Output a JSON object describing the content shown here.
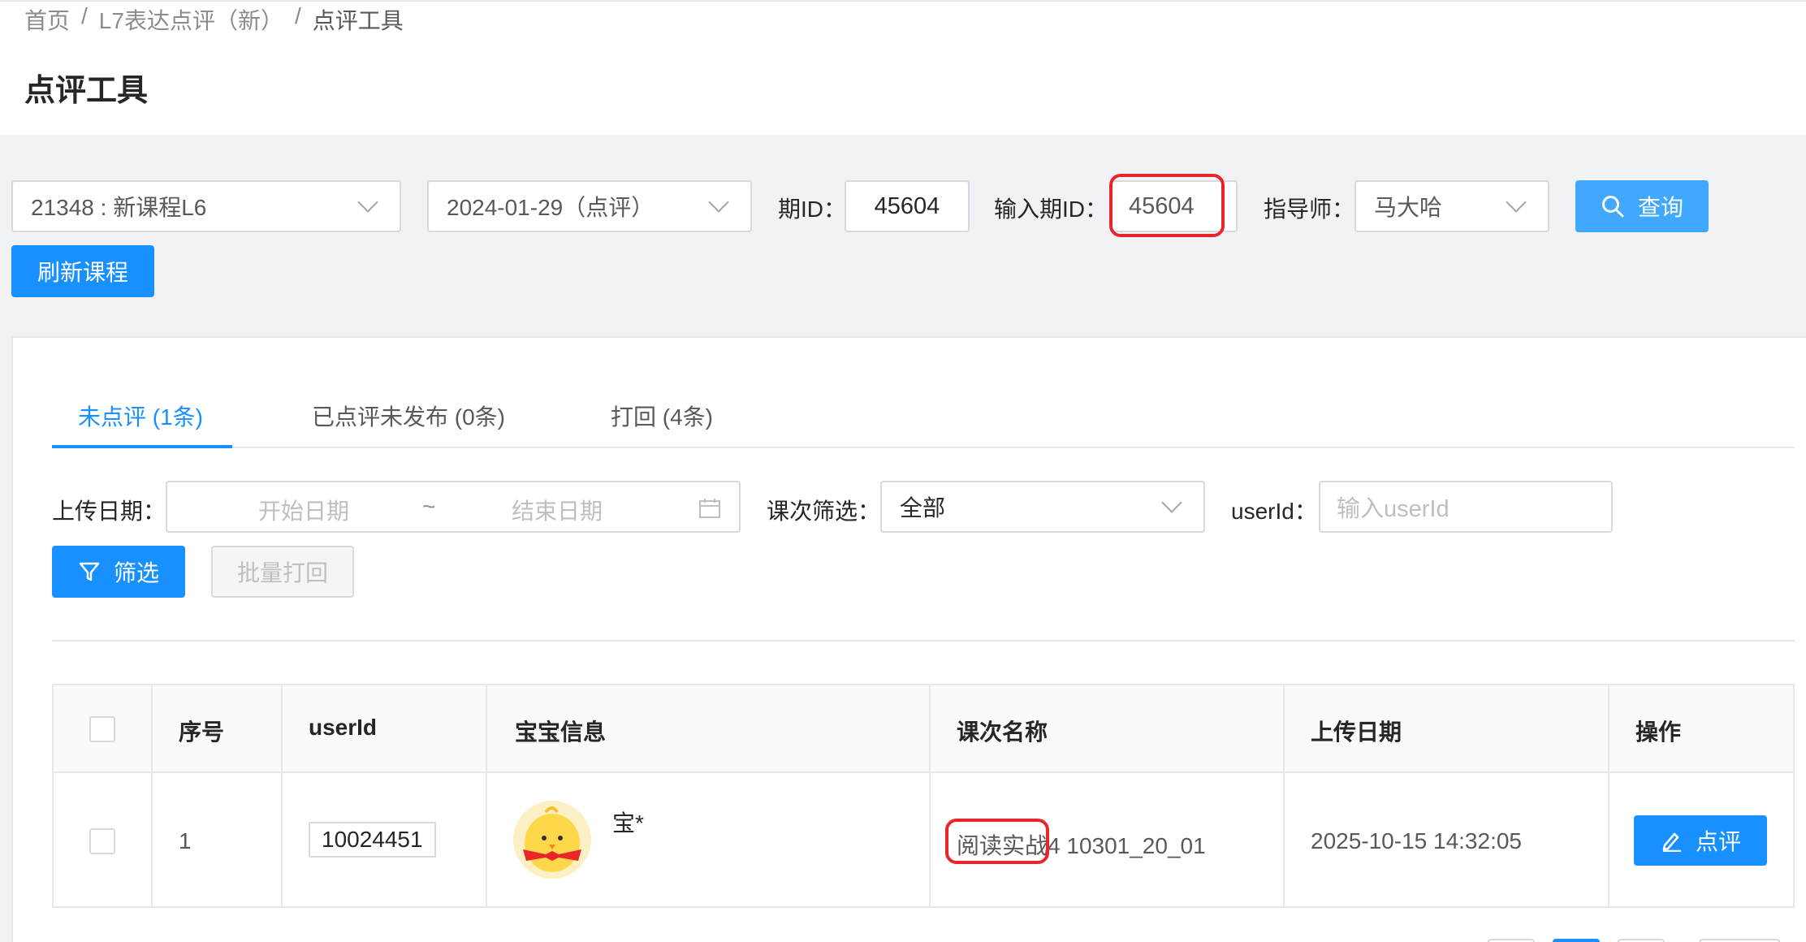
{
  "breadcrumb": {
    "home": "首页",
    "middle": "L7表达点评（新）",
    "current": "点评工具",
    "separator": "/"
  },
  "page_title": "点评工具",
  "toolbar": {
    "course_select": "21348 : 新课程L6",
    "date_select": "2024-01-29（点评）",
    "period_id_label": "期ID：",
    "period_id_value": "45604",
    "input_period_id_label": "输入期ID：",
    "input_period_id_value": "45604",
    "tutor_label": "指导师：",
    "tutor_value": "马大哈",
    "query_button": "查询",
    "refresh_button": "刷新课程"
  },
  "tabs": [
    {
      "label": "未点评 (1条)",
      "active": true
    },
    {
      "label": "已点评未发布 (0条)",
      "active": false
    },
    {
      "label": "打回 (4条)",
      "active": false
    }
  ],
  "filters": {
    "upload_date_label": "上传日期：",
    "start_placeholder": "开始日期",
    "range_sep": "~",
    "end_placeholder": "结束日期",
    "lesson_filter_label": "课次筛选：",
    "lesson_filter_value": "全部",
    "userid_label": "userId：",
    "userid_placeholder": "输入userId",
    "filter_button": "筛选",
    "batch_reject_button": "批量打回"
  },
  "table": {
    "columns": [
      "序号",
      "userId",
      "宝宝信息",
      "课次名称",
      "上传日期",
      "操作"
    ],
    "rows": [
      {
        "index": "1",
        "userId": "10024451",
        "baby_name": "宝*",
        "lesson_name_highlight": "阅读实战",
        "lesson_name_rest": "4 10301_20_01",
        "upload_date": "2025-10-15 14:32:05",
        "action": "点评"
      }
    ]
  },
  "colors": {
    "primary": "#1890ff",
    "highlight_ring": "#e8262a"
  }
}
